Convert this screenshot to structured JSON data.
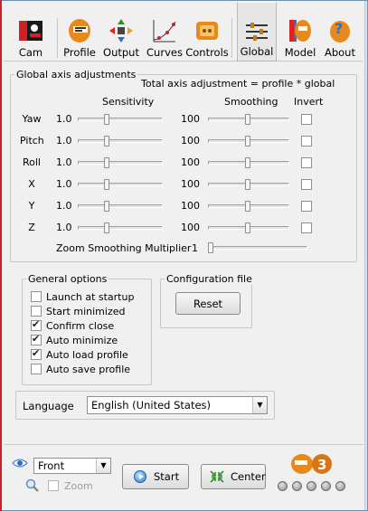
{
  "toolbar": {
    "items": [
      {
        "label": "Cam",
        "icon": "camera-icon"
      },
      {
        "label": "Profile",
        "icon": "profile-icon"
      },
      {
        "label": "Output",
        "icon": "output-icon"
      },
      {
        "label": "Curves",
        "icon": "curves-icon"
      },
      {
        "label": "Controls",
        "icon": "controls-icon"
      },
      {
        "label": "Global",
        "icon": "global-sliders-icon",
        "active": true
      },
      {
        "label": "Model",
        "icon": "model-icon"
      },
      {
        "label": "About",
        "icon": "about-icon"
      }
    ]
  },
  "global_axis": {
    "title": "Global axis adjustments",
    "formula": "Total axis adjustment = profile * global",
    "col_sensitivity": "Sensitivity",
    "col_smoothing": "Smoothing",
    "col_invert": "Invert",
    "rows": [
      {
        "label": "Yaw",
        "sensitivity": "1.0",
        "smoothing": "100",
        "invert": false
      },
      {
        "label": "Pitch",
        "sensitivity": "1.0",
        "smoothing": "100",
        "invert": false
      },
      {
        "label": "Roll",
        "sensitivity": "1.0",
        "smoothing": "100",
        "invert": false
      },
      {
        "label": "X",
        "sensitivity": "1.0",
        "smoothing": "100",
        "invert": false
      },
      {
        "label": "Y",
        "sensitivity": "1.0",
        "smoothing": "100",
        "invert": false
      },
      {
        "label": "Z",
        "sensitivity": "1.0",
        "smoothing": "100",
        "invert": false
      }
    ],
    "zoom_label": "Zoom Smoothing Multiplier",
    "zoom_value": "1"
  },
  "general_options": {
    "title": "General options",
    "items": [
      {
        "label": "Launch at startup",
        "checked": false
      },
      {
        "label": "Start minimized",
        "checked": false
      },
      {
        "label": "Confirm close",
        "checked": true
      },
      {
        "label": "Auto minimize",
        "checked": true
      },
      {
        "label": "Auto load profile",
        "checked": true
      },
      {
        "label": "Auto save profile",
        "checked": false
      }
    ]
  },
  "config_file": {
    "title": "Configuration file",
    "reset_label": "Reset"
  },
  "language": {
    "label": "Language",
    "selected": "English (United States)"
  },
  "bottom": {
    "view_selected": "Front",
    "zoom_label": "Zoom",
    "start_label": "Start",
    "center_label": "Center"
  },
  "colors": {
    "accent_red": "#c2262b",
    "logo_orange": "#e8891c"
  }
}
